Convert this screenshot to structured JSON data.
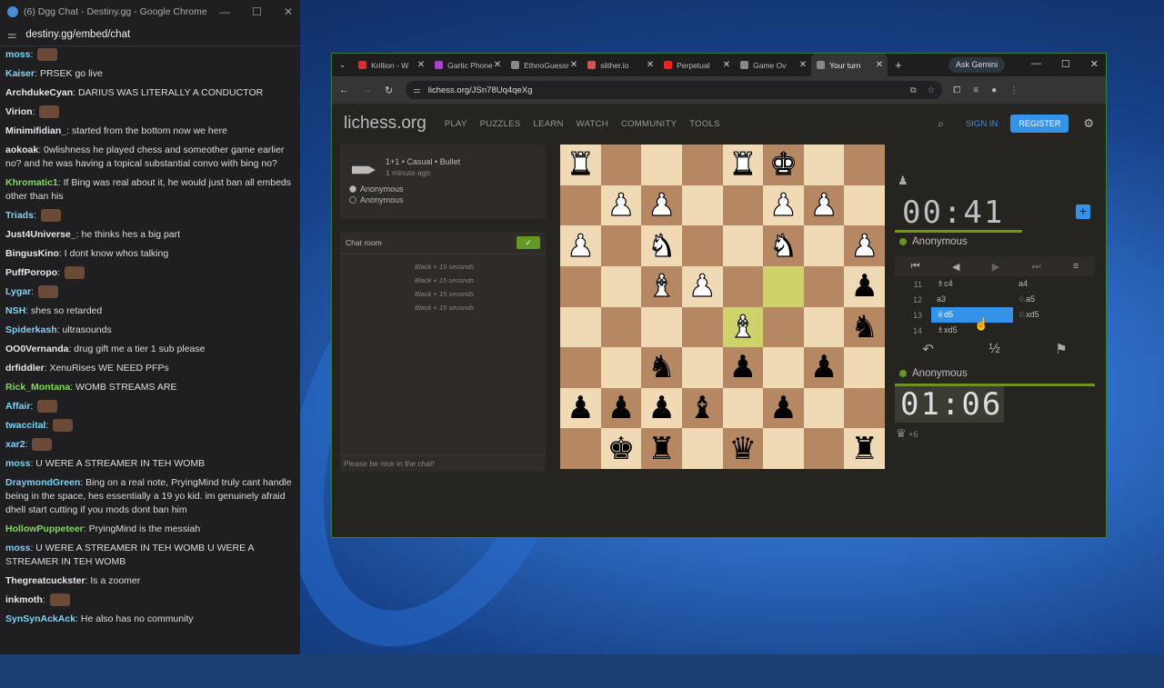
{
  "chat_window": {
    "title": "(6) Dgg Chat - Destiny.gg - Google Chrome",
    "url": "destiny.gg/embed/chat",
    "messages": [
      {
        "user": "moss",
        "color": "#7dd3f7",
        "text": ""
      },
      {
        "user": "Kaiser",
        "color": "#7dd3f7",
        "text": "PRSEK go live"
      },
      {
        "user": "ArchdukeCyan",
        "color": "#e8e8e8",
        "text": "DARIUS WAS LITERALLY A CONDUCTOR"
      },
      {
        "user": "Virion",
        "color": "#e8e8e8",
        "text": ""
      },
      {
        "user": "Minimifidian_",
        "color": "#e8e8e8",
        "text": "started from the bottom now we here"
      },
      {
        "user": "aokoak",
        "color": "#e8e8e8",
        "text": "0wlishness he played chess and someother game earlier no? and he was having a topical substantial convo with bing no?"
      },
      {
        "user": "Khromatic1",
        "color": "#7fdc5a",
        "text": "If Bing was real about it, he would just ban all embeds other than his"
      },
      {
        "user": "Triads",
        "color": "#7dd3f7",
        "text": ""
      },
      {
        "user": "Just4Universe_",
        "color": "#e8e8e8",
        "text": "he thinks hes a big part"
      },
      {
        "user": "BingusKino",
        "color": "#e8e8e8",
        "text": "I dont know whos talking"
      },
      {
        "user": "PuffPoropo",
        "color": "#e8e8e8",
        "text": ""
      },
      {
        "user": "Lygar",
        "color": "#7dd3f7",
        "text": ""
      },
      {
        "user": "NSH",
        "color": "#7dd3f7",
        "text": "shes so retarded"
      },
      {
        "user": "Spiderkash",
        "color": "#7dd3f7",
        "text": "ultrasounds"
      },
      {
        "user": "OO0Vernanda",
        "color": "#e8e8e8",
        "text": "drug gift me a tier 1 sub please"
      },
      {
        "user": "drfiddler",
        "color": "#e8e8e8",
        "text": "XenuRises WE NEED PFPs"
      },
      {
        "user": "Rick_Montana",
        "color": "#7fdc5a",
        "text": "WOMB STREAMS ARE"
      },
      {
        "user": "Affair",
        "color": "#7dd3f7",
        "text": ""
      },
      {
        "user": "twaccital",
        "color": "#7dd3f7",
        "text": ""
      },
      {
        "user": "xar2",
        "color": "#7dd3f7",
        "text": ""
      },
      {
        "user": "moss",
        "color": "#7dd3f7",
        "text": "U WERE A STREAMER IN TEH WOMB"
      },
      {
        "user": "DraymondGreen",
        "color": "#7dd3f7",
        "text": "Bing on a real note, PryingMind truly cant handle being in the space, hes essentially a 19 yo kid. im genuinely afraid dhell start cutting if you mods dont ban him"
      },
      {
        "user": "HollowPuppeteer",
        "color": "#7fdc5a",
        "text": "PryingMind is the messiah"
      },
      {
        "user": "moss",
        "color": "#7dd3f7",
        "text": "U WERE A STREAMER IN TEH WOMB U WERE A STREAMER IN TEH WOMB"
      },
      {
        "user": "Thegreatcuckster",
        "color": "#e8e8e8",
        "text": "Is a zoomer"
      },
      {
        "user": "inkmoth",
        "color": "#e8e8e8",
        "text": ""
      },
      {
        "user": "SynSynAckAck",
        "color": "#7dd3f7",
        "text": "He also has no community"
      }
    ]
  },
  "browser": {
    "tabs": [
      {
        "label": "Krillion - W",
        "color": "#c33"
      },
      {
        "label": "Gartic Phone",
        "color": "#a4c"
      },
      {
        "label": "EthnoGuessr",
        "color": "#888"
      },
      {
        "label": "slither.io",
        "color": "#c55"
      },
      {
        "label": "Perpetual",
        "color": "#e22"
      },
      {
        "label": "Game Ov",
        "color": "#888"
      },
      {
        "label": "Your turn",
        "color": "#888"
      }
    ],
    "new_tab": "+",
    "gemini": "Ask Gemini",
    "url": "lichess.org/JSn78Uq4qeXg"
  },
  "lichess": {
    "logo": "lichess.org",
    "nav": [
      "PLAY",
      "PUZZLES",
      "LEARN",
      "WATCH",
      "COMMUNITY",
      "TOOLS"
    ],
    "sign_in": "SIGN IN",
    "register": "REGISTER",
    "game": {
      "mode": "1+1 • Casual • Bullet",
      "age": "1 minute ago",
      "white": "Anonymous",
      "black": "Anonymous"
    },
    "chat": {
      "title": "Chat room",
      "system": [
        "Black + 15 seconds",
        "Black + 15 seconds",
        "Black + 15 seconds",
        "Black + 15 seconds"
      ],
      "placeholder": "Please be nice in the chat!"
    },
    "board": [
      [
        "wR",
        "",
        "",
        "",
        "wR",
        "wK",
        "",
        ""
      ],
      [
        "",
        "wP",
        "wP",
        "",
        "",
        "wP",
        "wP",
        ""
      ],
      [
        "wP",
        "",
        "wN",
        "",
        "",
        "wN",
        "",
        "wP"
      ],
      [
        "",
        "",
        "wB",
        "wP",
        "",
        "",
        "",
        "bP"
      ],
      [
        "",
        "",
        "",
        "",
        "wB",
        "",
        "",
        "bN"
      ],
      [
        "",
        "",
        "bN",
        "",
        "bP",
        "",
        "bP",
        ""
      ],
      [
        "bP",
        "bP",
        "bP",
        "bB",
        "",
        "bP",
        "",
        ""
      ],
      [
        "",
        "bK",
        "bR",
        "",
        "bQ",
        "",
        "",
        "bR"
      ]
    ],
    "highlight": [
      [
        3,
        5
      ],
      [
        4,
        4
      ]
    ],
    "opponent_clock": "00:41",
    "opponent": "Anonymous",
    "player": "Anonymous",
    "player_clock": "01:06",
    "moves": [
      {
        "n": "11",
        "w": "♗c4",
        "b": "a4"
      },
      {
        "n": "12",
        "w": "a3",
        "b": "♘a5"
      },
      {
        "n": "13",
        "w": "♕d5",
        "b": "♘xd5"
      },
      {
        "n": "14",
        "w": "♗xd5",
        "b": ""
      }
    ],
    "material": "+6"
  }
}
